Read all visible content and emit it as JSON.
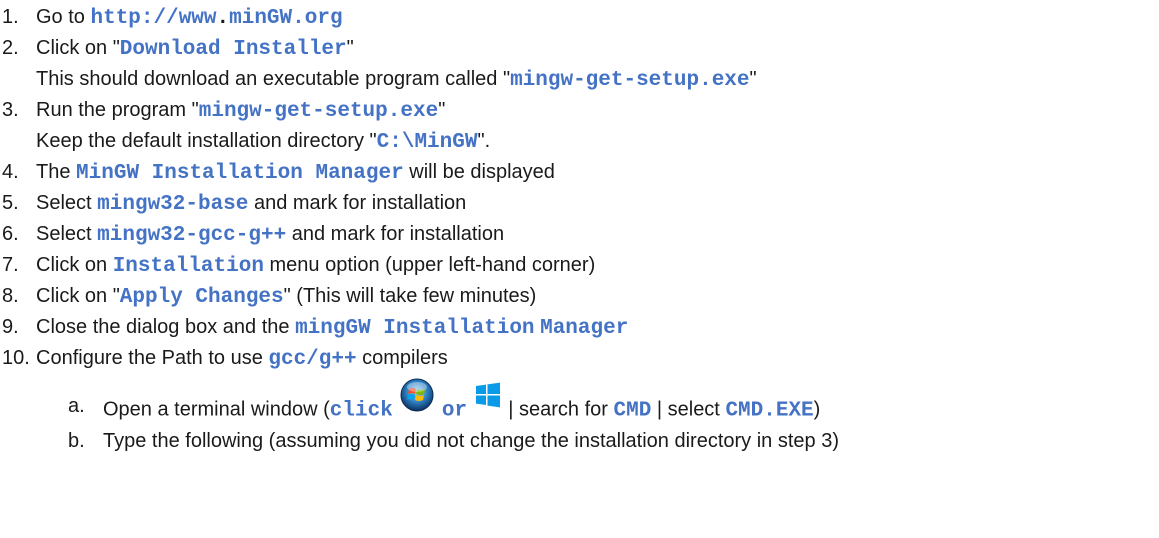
{
  "steps": [
    {
      "num": "1.",
      "parts": [
        "Go to ",
        "http://www",
        ".",
        "minGW.org"
      ]
    },
    {
      "num": "2.",
      "parts": [
        "Click on \"",
        "Download Installer",
        "\""
      ],
      "cont": [
        "This should download an executable program called \"",
        "mingw-get-setup.exe",
        "\""
      ]
    },
    {
      "num": "3.",
      "parts": [
        "Run the program \"",
        "mingw-get-setup.exe",
        "\""
      ],
      "cont": [
        "Keep the default installation directory \"",
        "C:\\MinGW",
        "\"."
      ]
    },
    {
      "num": "4.",
      "parts": [
        "The ",
        "MinGW Installation Manager",
        " will be displayed"
      ]
    },
    {
      "num": "5.",
      "parts": [
        "Select ",
        "mingw32-base",
        " and mark for installation"
      ]
    },
    {
      "num": "6.",
      "parts": [
        "Select ",
        "mingw32-gcc-g++",
        " and mark for installation"
      ]
    },
    {
      "num": "7.",
      "parts": [
        "Click on ",
        "Installation",
        " menu option (upper left-hand corner)"
      ]
    },
    {
      "num": "8.",
      "parts": [
        "Click on \"",
        "Apply Changes",
        "\" (This will take few minutes)"
      ]
    },
    {
      "num": "9.",
      "parts": [
        "Close the dialog box and the ",
        "mingGW Installation",
        " ",
        "Manager"
      ]
    },
    {
      "num": "10.",
      "parts": [
        "Configure the Path to use ",
        "gcc/g++",
        " compilers"
      ]
    }
  ],
  "substeps": [
    {
      "letter": "a.",
      "parts": [
        "Open a terminal window (",
        "click",
        " ",
        "or",
        " | search for ",
        "CMD",
        " | select ",
        "CMD.EXE",
        ")"
      ]
    },
    {
      "letter": "b.",
      "parts": [
        "Type the following (assuming you did not change the installation directory in step 3)"
      ]
    }
  ],
  "icons": {
    "windows7": "windows-7-start-orb-icon",
    "windows10": "windows-10-logo-icon"
  },
  "colors": {
    "code": "#4472c4",
    "text": "#1a1a1a"
  }
}
